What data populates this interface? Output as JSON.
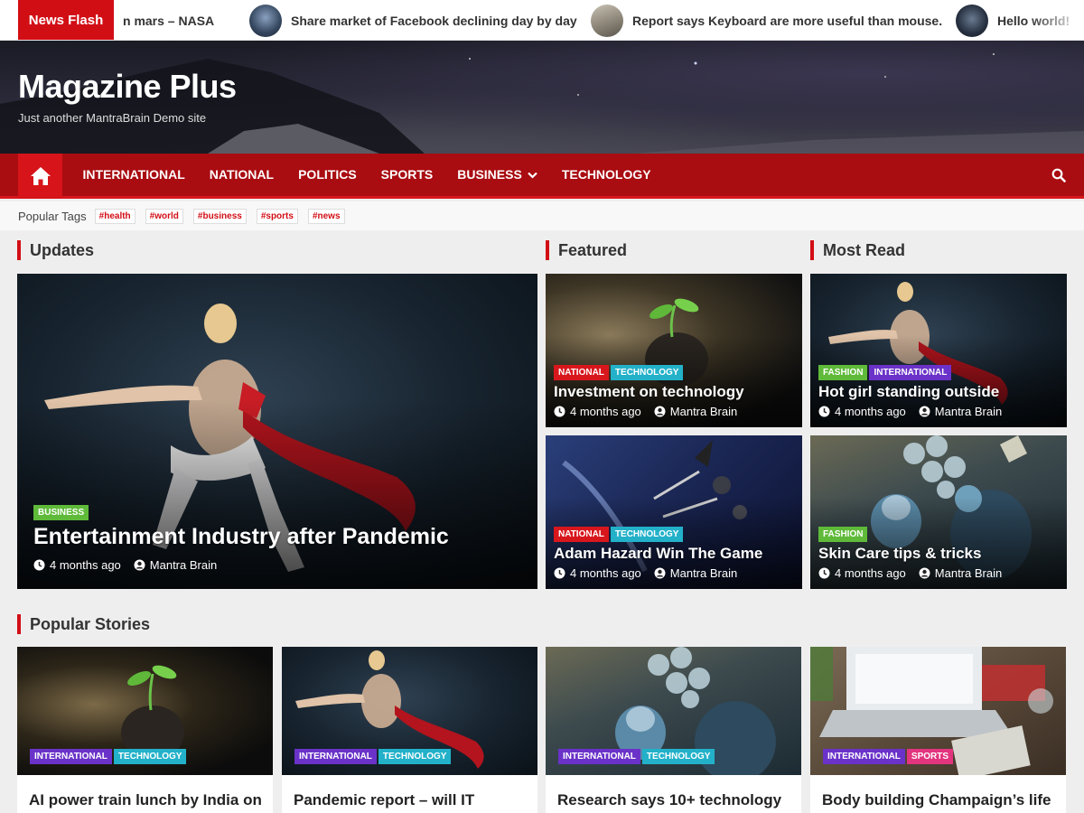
{
  "ticker": {
    "label": "News Flash",
    "items": [
      "n mars – NASA",
      "Share market of Facebook declining day by day",
      "Report says Keyboard are more useful than mouse.",
      "Hello world!"
    ]
  },
  "site": {
    "title": "Magazine Plus",
    "description": "Just another MantraBrain Demo site"
  },
  "nav": {
    "items": [
      "INTERNATIONAL",
      "NATIONAL",
      "POLITICS",
      "SPORTS",
      "BUSINESS",
      "TECHNOLOGY"
    ],
    "home_icon": "home-icon",
    "search_icon": "search-icon",
    "dropdown_icon": "chevron-down-icon"
  },
  "tags": {
    "label": "Popular Tags",
    "items": [
      "#health",
      "#world",
      "#business",
      "#sports",
      "#news"
    ]
  },
  "sections": {
    "updates": "Updates",
    "featured": "Featured",
    "most_read": "Most Read",
    "popular": "Popular Stories"
  },
  "updates": {
    "cats": [
      "BUSINESS"
    ],
    "title": "Entertainment Industry after Pandemic",
    "time": "4 months ago",
    "author": "Mantra Brain"
  },
  "featured": [
    {
      "cats": [
        "NATIONAL",
        "TECHNOLOGY"
      ],
      "title": "Investment on technology",
      "time": "4 months ago",
      "author": "Mantra Brain"
    },
    {
      "cats": [
        "NATIONAL",
        "TECHNOLOGY"
      ],
      "title": "Adam Hazard Win The Game",
      "time": "4 months ago",
      "author": "Mantra Brain"
    }
  ],
  "most_read": [
    {
      "cats": [
        "FASHION",
        "INTERNATIONAL"
      ],
      "title": "Hot girl standing outside",
      "time": "4 months ago",
      "author": "Mantra Brain"
    },
    {
      "cats": [
        "FASHION"
      ],
      "title": "Skin Care tips & tricks",
      "time": "4 months ago",
      "author": "Mantra Brain"
    }
  ],
  "popular": [
    {
      "cats": [
        "INTERNATIONAL",
        "TECHNOLOGY"
      ],
      "title": "AI power train lunch by India on"
    },
    {
      "cats": [
        "INTERNATIONAL",
        "TECHNOLOGY"
      ],
      "title": "Pandemic report – will IT"
    },
    {
      "cats": [
        "INTERNATIONAL",
        "TECHNOLOGY"
      ],
      "title": "Research says 10+ technology"
    },
    {
      "cats": [
        "INTERNATIONAL",
        "SPORTS"
      ],
      "title": "Body building Champaign’s life"
    }
  ],
  "colors": {
    "brand_red": "#d20e15",
    "nav_red": "#a90c11",
    "business": "#5fba3a",
    "fashion": "#5fba3a",
    "national": "#d8171d",
    "technology": "#23b1c9",
    "international": "#6a32c8",
    "sports": "#e2357e"
  },
  "meta_icons": [
    "clock-icon",
    "user-icon"
  ]
}
